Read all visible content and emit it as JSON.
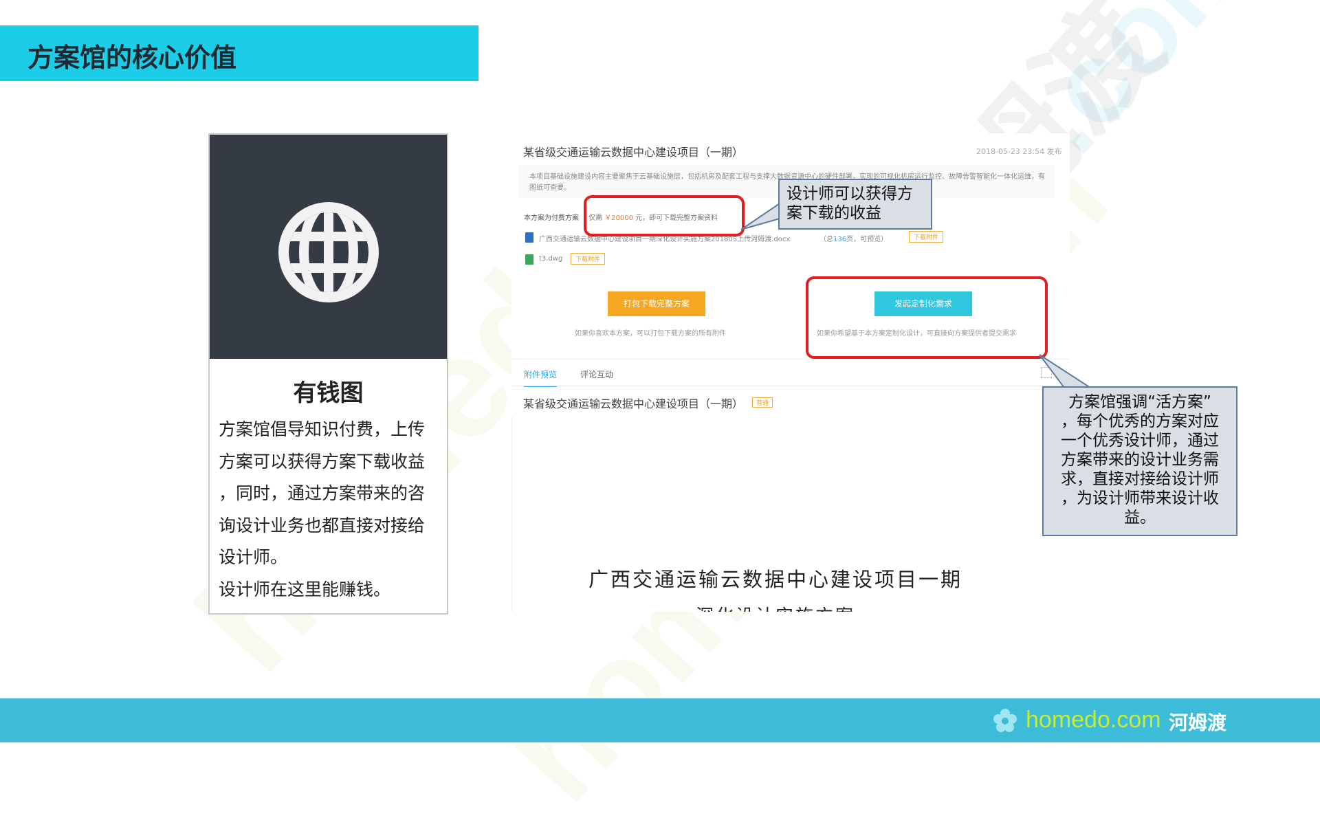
{
  "slide": {
    "title": "方案馆的核心价值",
    "watermark": "homedo.com 河姆渡"
  },
  "card": {
    "heading": "有钱图",
    "lines": [
      "方案馆倡导知识付费，上传",
      "方案可以获得方案下载收益",
      "，同时，通过方案带来的咨",
      "询设计业务也都直接对接给",
      "设计师。",
      "设计师在这里能赚钱。"
    ]
  },
  "screenshot": {
    "project_title": "某省级交通运输云数据中心建设项目（一期）",
    "date": "2018-05-23 23:54 发布",
    "description": "本项目基础设施建设内容主要聚焦于云基础设施层，包括机房及配套工程与支撑大数据资源中心的硬件部署，实现的可视化机房运行监控、故障告警智能化一体化运维，有图纸可查要。",
    "pay_label": "本方案为付费方案",
    "pay_prefix": "仅需",
    "pay_amount": "￥20000",
    "pay_suffix": "元，即可下载完整方案资料",
    "files": [
      {
        "name": "广西交通运输云数据中心建设项目一期深化设计实施方案201805上传河姆渡.docx",
        "pages_prefix": "（总",
        "pages": "136",
        "pages_suffix": "页，可预览）",
        "action": "下载附件"
      },
      {
        "name": "t3.dwg",
        "action": "下载附件"
      }
    ],
    "buttons": {
      "download_all": "打包下载完整方案",
      "download_note": "如果你喜欢本方案，可以打包下载方案的所有附件",
      "custom_request": "发起定制化需求",
      "custom_note": "如果你希望基于本方案定制化设计，可直接向方案提供者提交需求"
    },
    "tabs": [
      {
        "label": "附件预览",
        "active": true
      },
      {
        "label": "评论互动",
        "active": false
      }
    ],
    "preview_title": "某省级交通运输云数据中心建设项目（一期）",
    "preview_tag": "普通",
    "doc_title": "广西交通运输云数据中心建设项目一期",
    "doc_subtitle": "深化设计实施方案"
  },
  "callouts": {
    "download_income": [
      "设计师可以获得方",
      "案下载的收益"
    ],
    "living_plan": [
      "方案馆强调“活方案”",
      "，每个优秀的方案对应",
      "一个优秀设计师，通过",
      "方案带来的设计业务需",
      "求，直接对接给设计师",
      "，为设计师带来设计收",
      "益。"
    ]
  },
  "footer": {
    "brand_latin": "homedo.com",
    "brand_cn": "河姆渡"
  },
  "colors": {
    "title_bar": "#1bcde6",
    "card_dark": "#353b44",
    "highlight": "#e02020",
    "callout_fill": "#dadfe6",
    "callout_border": "#5b7c9e",
    "footer": "#3cbcd8",
    "brand_green": "#c7ec33"
  },
  "icons": {
    "globe": "globe-icon",
    "doc_file": "word-file-icon",
    "dwg_file": "dwg-file-icon",
    "expand": "expand-icon",
    "brand": "homedo-flower-icon"
  }
}
